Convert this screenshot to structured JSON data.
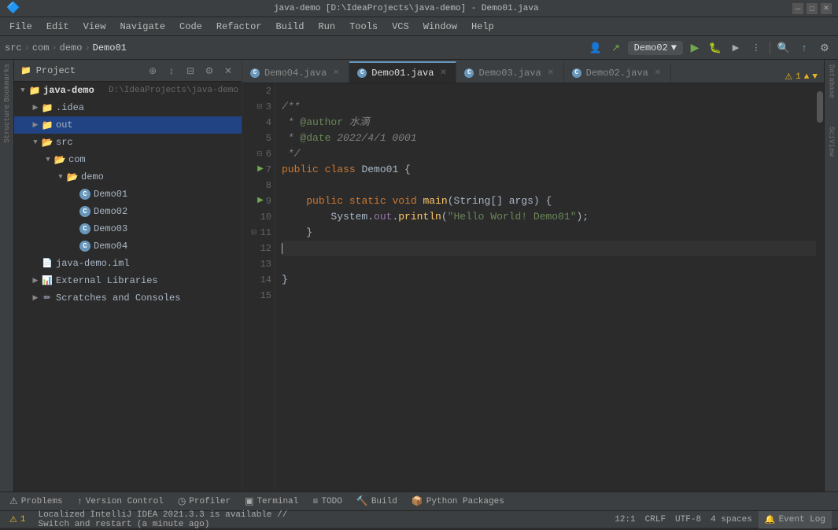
{
  "titleBar": {
    "title": "java-demo [D:\\IdeaProjects\\java-demo] - Demo01.java",
    "menuItems": [
      "File",
      "Edit",
      "View",
      "Navigate",
      "Code",
      "Refactor",
      "Build",
      "Run",
      "Tools",
      "VCS",
      "Window",
      "Help"
    ]
  },
  "breadcrumb": {
    "items": [
      "src",
      "com",
      "demo",
      "Demo01"
    ]
  },
  "runConfig": {
    "name": "Demo02",
    "dropdownArrow": "▼"
  },
  "sidebar": {
    "title": "Project",
    "root": {
      "name": "java-demo",
      "path": "D:\\IdeaProjects\\java-demo",
      "children": [
        {
          "id": "idea",
          "label": ".idea",
          "type": "folder",
          "indent": 1
        },
        {
          "id": "out",
          "label": "out",
          "type": "folder-selected",
          "indent": 1
        },
        {
          "id": "src",
          "label": "src",
          "type": "folder-open",
          "indent": 1,
          "children": [
            {
              "id": "com",
              "label": "com",
              "type": "folder-open",
              "indent": 2,
              "children": [
                {
                  "id": "demo",
                  "label": "demo",
                  "type": "folder-open",
                  "indent": 3,
                  "children": [
                    {
                      "id": "Demo01",
                      "label": "Demo01",
                      "type": "java",
                      "indent": 4
                    },
                    {
                      "id": "Demo02",
                      "label": "Demo02",
                      "type": "java",
                      "indent": 4
                    },
                    {
                      "id": "Demo03",
                      "label": "Demo03",
                      "type": "java",
                      "indent": 4
                    },
                    {
                      "id": "Demo04",
                      "label": "Demo04",
                      "type": "java",
                      "indent": 4
                    }
                  ]
                }
              ]
            }
          ]
        },
        {
          "id": "java-demo-iml",
          "label": "java-demo.iml",
          "type": "iml",
          "indent": 1
        },
        {
          "id": "external-libs",
          "label": "External Libraries",
          "type": "libs",
          "indent": 1
        },
        {
          "id": "scratches",
          "label": "Scratches and Consoles",
          "type": "scratches",
          "indent": 1
        }
      ]
    }
  },
  "tabs": [
    {
      "id": "Demo04",
      "label": "Demo04.java",
      "active": false,
      "modified": false
    },
    {
      "id": "Demo01",
      "label": "Demo01.java",
      "active": true,
      "modified": false
    },
    {
      "id": "Demo03",
      "label": "Demo03.java",
      "active": false,
      "modified": false
    },
    {
      "id": "Demo02",
      "label": "Demo02.java",
      "active": false,
      "modified": false
    }
  ],
  "editor": {
    "lines": [
      {
        "num": 2,
        "content": "",
        "arrow": false,
        "fold": false,
        "current": false
      },
      {
        "num": 3,
        "content": "/**",
        "arrow": false,
        "fold": true,
        "current": false
      },
      {
        "num": 4,
        "content": " * @author 水滴",
        "arrow": false,
        "fold": false,
        "current": false
      },
      {
        "num": 5,
        "content": " * @date 2022/4/1 0001",
        "arrow": false,
        "fold": false,
        "current": false
      },
      {
        "num": 6,
        "content": " */",
        "arrow": false,
        "fold": true,
        "current": false
      },
      {
        "num": 7,
        "content": "public class Demo01 {",
        "arrow": true,
        "fold": false,
        "current": false
      },
      {
        "num": 8,
        "content": "",
        "arrow": false,
        "fold": false,
        "current": false
      },
      {
        "num": 9,
        "content": "    public static void main(String[] args) {",
        "arrow": true,
        "fold": true,
        "current": false
      },
      {
        "num": 10,
        "content": "        System.out.println(\"Hello World! Demo01\");",
        "arrow": false,
        "fold": false,
        "current": false
      },
      {
        "num": 11,
        "content": "    }",
        "arrow": false,
        "fold": true,
        "current": false
      },
      {
        "num": 12,
        "content": "",
        "arrow": false,
        "fold": false,
        "current": true
      },
      {
        "num": 13,
        "content": "",
        "arrow": false,
        "fold": false,
        "current": false
      },
      {
        "num": 14,
        "content": "}",
        "arrow": false,
        "fold": false,
        "current": false
      },
      {
        "num": 15,
        "content": "",
        "arrow": false,
        "fold": false,
        "current": false
      }
    ]
  },
  "statusBar": {
    "warningCount": "▲ 1",
    "positionInfo": "12:1",
    "lineEnding": "CRLF",
    "encoding": "UTF-8",
    "indent": "4 spaces",
    "statusMessage": "Localized IntelliJ IDEA 2021.3.3 is available // Switch and restart (a minute ago)",
    "eventLog": "🔔 Event Log"
  },
  "bottomToolbar": {
    "items": [
      {
        "id": "problems",
        "icon": "⚠",
        "label": "Problems"
      },
      {
        "id": "version-control",
        "icon": "↑",
        "label": "Version Control"
      },
      {
        "id": "profiler",
        "icon": "◷",
        "label": "Profiler"
      },
      {
        "id": "terminal",
        "icon": "▣",
        "label": "Terminal"
      },
      {
        "id": "todo",
        "icon": "≡",
        "label": "TODO"
      },
      {
        "id": "build",
        "icon": "🔨",
        "label": "Build"
      },
      {
        "id": "python-packages",
        "icon": "📦",
        "label": "Python Packages"
      }
    ]
  },
  "rightSidebar": {
    "items": [
      {
        "id": "database",
        "label": "Database"
      },
      {
        "id": "sciview",
        "label": "SciView"
      }
    ]
  }
}
